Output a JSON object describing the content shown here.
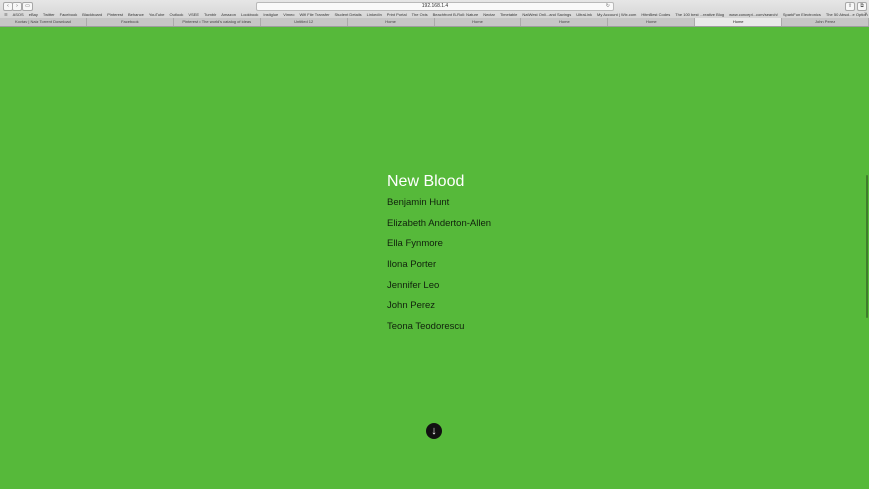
{
  "browser": {
    "nav_buttons": [
      "‹",
      "›",
      "▭"
    ],
    "address": "192.168.1.4",
    "reload_icon": "↻",
    "right_buttons": [
      "⇪",
      "⧉"
    ],
    "bookmarks_icon": "☰",
    "bookmarks": [
      "ASOS",
      "eBay",
      "Twitter",
      "Facebook",
      "Blackboard",
      "Pinterest",
      "Behance",
      "YouTube",
      "Outlook",
      "VSEE",
      "Tumblr",
      "Amazon",
      "Lookbook",
      "Instiglue",
      "Vimeo",
      "Wifi File Transfer",
      "Student Details",
      "LinkedIn",
      "Print Portal",
      "The Oxis",
      "Beachfront B-Roll: Nature",
      "Nectar",
      "Timetable",
      "NatWest Onli...and Savings",
      "UltraLink",
      "My Account | Wix.com",
      "HitmBest Codes",
      "The 100 best ...reative Blog",
      "www.concept...com/search/",
      "SparkFun Electronics",
      "The 50 Absol...e Option 5Ps",
      "Student Details"
    ],
    "bookmarks_more": "»",
    "tabs": [
      {
        "label": "Kovtav | Naiz Torrent Download",
        "active": false
      },
      {
        "label": "Facebook",
        "active": false
      },
      {
        "label": "Pinterest • The world's catalog of ideas",
        "active": false
      },
      {
        "label": "Untitled 12",
        "active": false
      },
      {
        "label": "Home",
        "active": false
      },
      {
        "label": "Home",
        "active": false
      },
      {
        "label": "Home",
        "active": false
      },
      {
        "label": "Home",
        "active": false
      },
      {
        "label": "Home",
        "active": true
      },
      {
        "label": "John Perez",
        "active": false
      }
    ]
  },
  "page": {
    "background_color": "#56b93a",
    "credits_title": "New Blood",
    "names": [
      "Benjamin Hunt",
      "Elizabeth Anderton-Allen",
      "Ella Fynmore",
      "Ilona Porter",
      "Jennifer Leo",
      "John Perez",
      "Teona Teodorescu"
    ],
    "scroll_button_icon": "↓",
    "scroll_icon_name": "arrow-down-icon"
  }
}
